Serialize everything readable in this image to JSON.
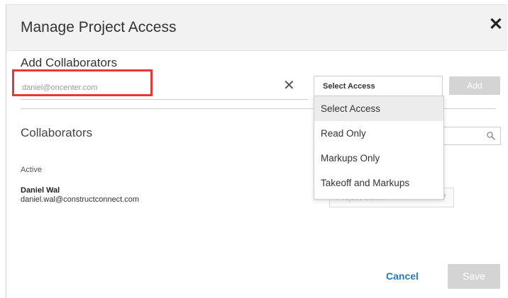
{
  "dialog": {
    "title": "Manage Project Access",
    "close_glyph": "✕"
  },
  "add_collaborators": {
    "heading": "Add Collaborators",
    "email_value": "daniel@oncenter.com",
    "clear_glyph": "✕",
    "access_select_label": "Select Access",
    "access_options": [
      "Select Access",
      "Read Only",
      "Markups Only",
      "Takeoff and Markups"
    ],
    "selected_option_index": 0,
    "add_label": "Add"
  },
  "collaborators": {
    "heading": "Collaborators",
    "search_icon": "search-icon",
    "group_label": "Active",
    "rows": [
      {
        "name": "Daniel Wal",
        "email": "daniel.wal@constructconnect.com",
        "role": "Project Owner"
      }
    ]
  },
  "footer": {
    "cancel_label": "Cancel",
    "save_label": "Save"
  },
  "colors": {
    "highlight_border": "#e53935",
    "cancel_link": "#2a78b6",
    "disabled_button": "#d4d4d4",
    "header_bg": "#f2f2f2"
  }
}
